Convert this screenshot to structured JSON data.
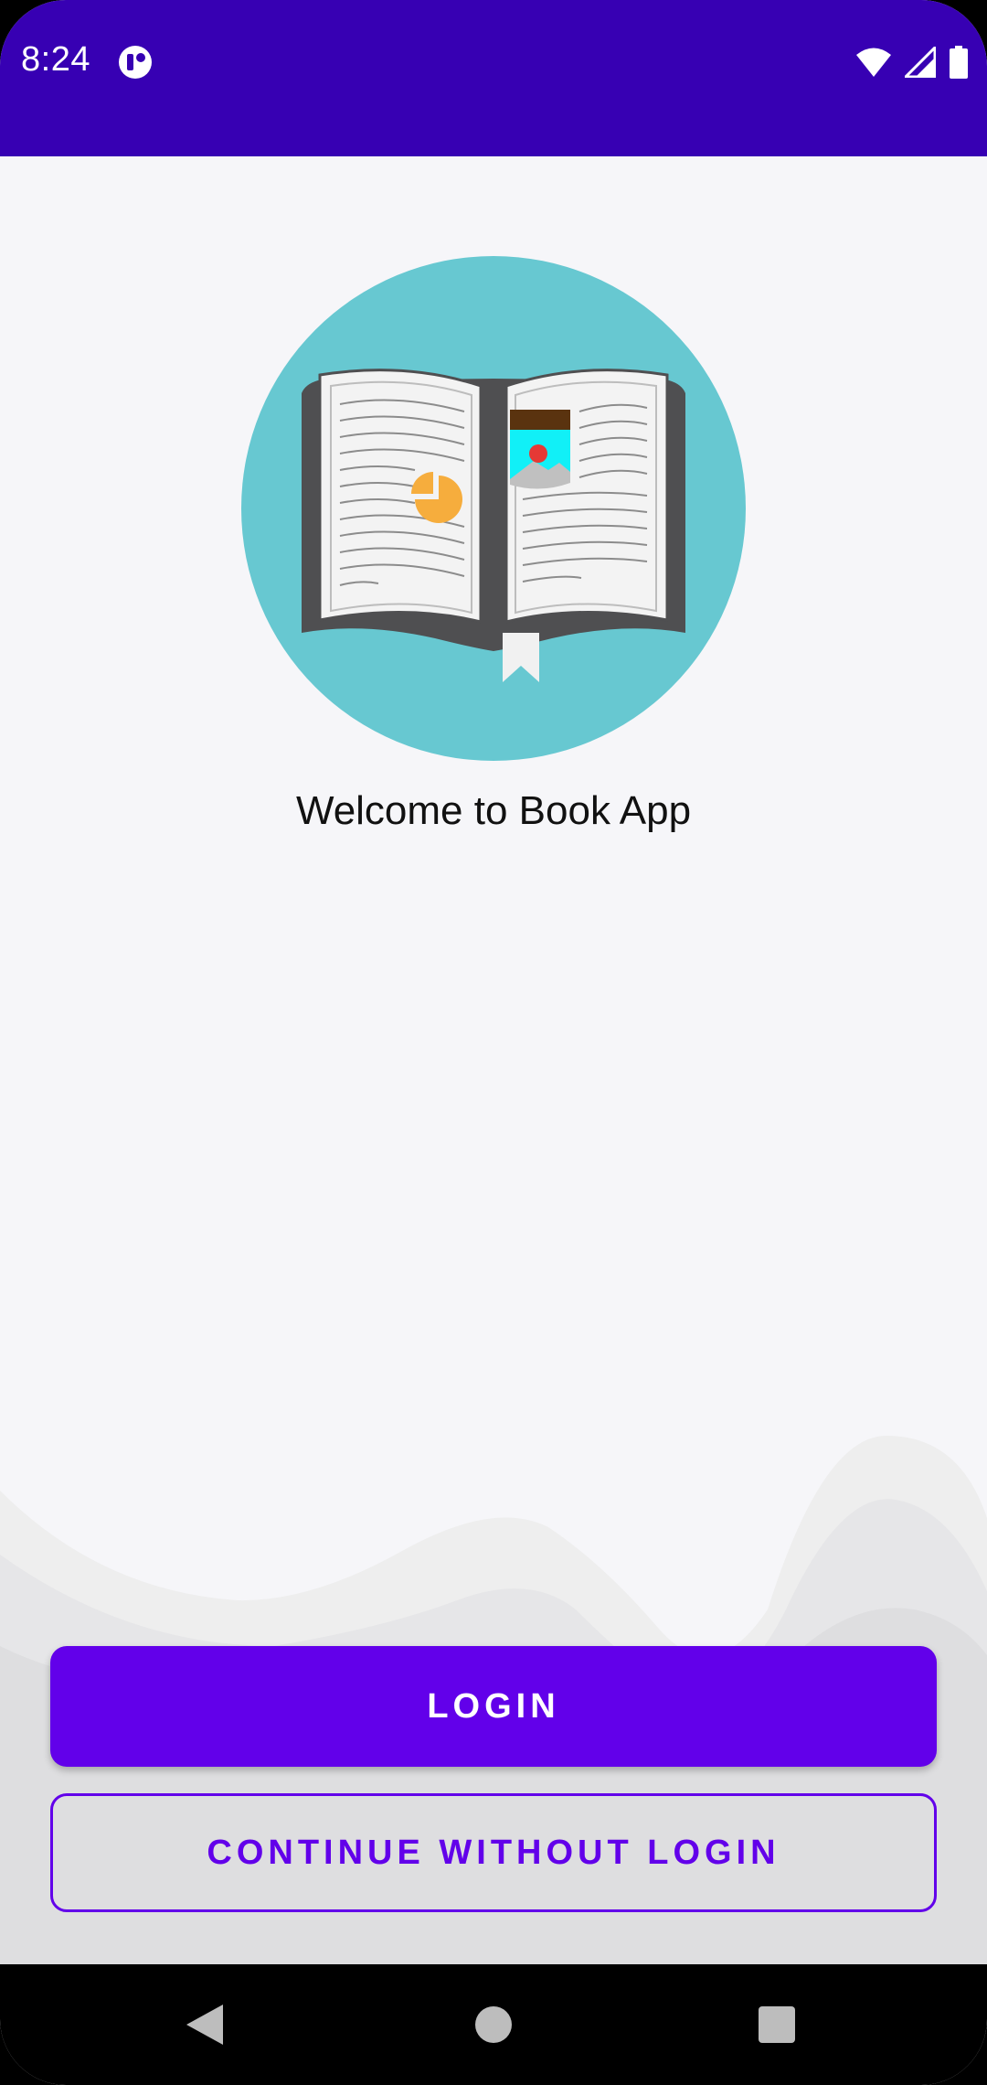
{
  "status_bar": {
    "time": "8:24",
    "app_icon": "notification-app-icon",
    "icons": [
      "wifi-icon",
      "cellular-signal-icon",
      "battery-icon"
    ],
    "background_color": "#3700b3"
  },
  "main": {
    "logo_icon": "open-book-icon",
    "welcome_text": "Welcome to Book App"
  },
  "actions": {
    "login_label": "LOGIN",
    "continue_label": "CONTINUE WITHOUT LOGIN",
    "accent_color": "#6200ea"
  },
  "nav_bar": {
    "icons": [
      "back-icon",
      "home-icon",
      "recents-icon"
    ]
  }
}
